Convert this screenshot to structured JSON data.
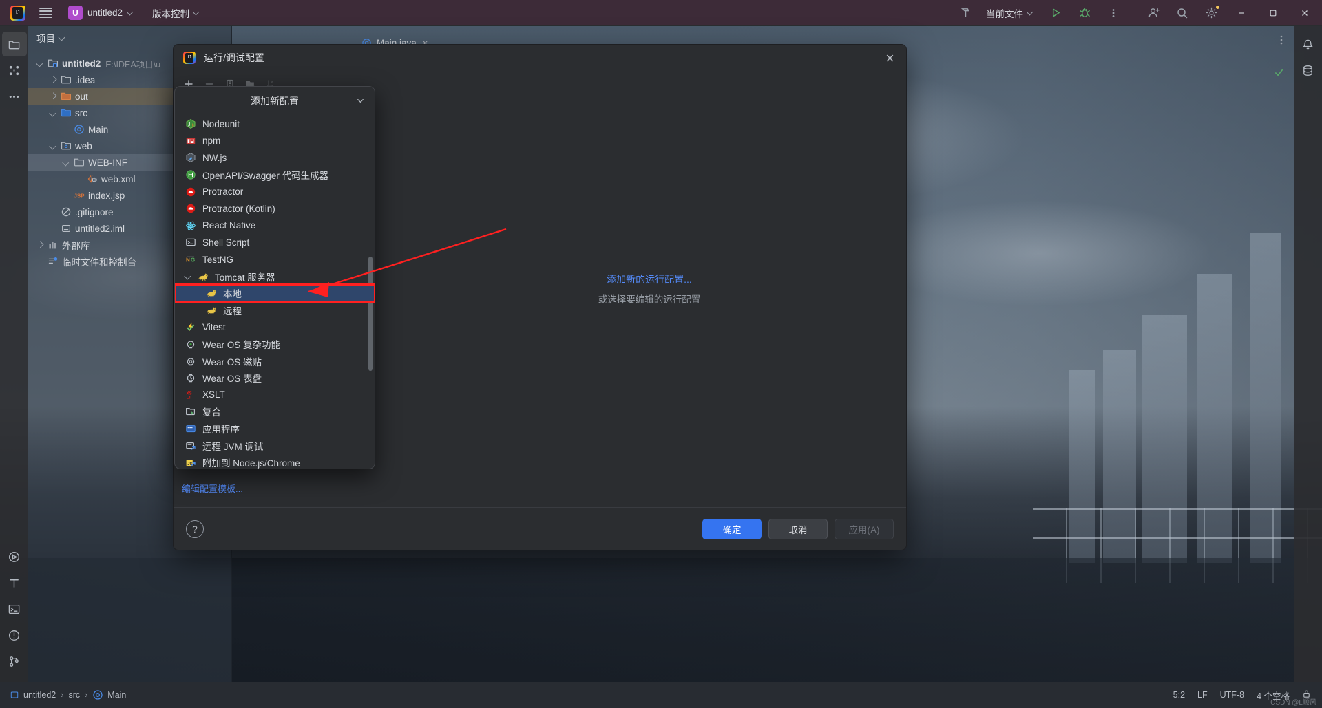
{
  "titlebar": {
    "menu_icon": "hamburger-menu-icon",
    "app_logo": "intellij-idea-logo",
    "project_badge": "U",
    "project_name": "untitled2",
    "vcs_label": "版本控制",
    "build_icon": "hammer-build-icon",
    "run_config_label": "当前文件",
    "run_icon": "run-triangle-icon",
    "debug_icon": "debug-bug-icon",
    "more_icon": "more-vertical-icon",
    "account_icon": "user-account-icon",
    "search_icon": "magnifier-search-icon",
    "settings_icon": "gear-settings-icon",
    "minimize": "−",
    "maximize": "◻",
    "close": "✕"
  },
  "activitybar": {
    "items": [
      {
        "name": "project-folder",
        "icon": "folder-icon"
      },
      {
        "name": "structure",
        "icon": "structure-icon"
      },
      {
        "name": "more-tool-windows",
        "icon": "ellipsis-icon"
      }
    ],
    "bottom_items": [
      {
        "name": "run",
        "icon": "run-circle-icon"
      },
      {
        "name": "ai-assistant",
        "icon": "text-tool-icon"
      },
      {
        "name": "terminal",
        "icon": "terminal-icon"
      },
      {
        "name": "problems",
        "icon": "warning-circle-icon"
      },
      {
        "name": "version-control-branch",
        "icon": "branch-icon"
      }
    ]
  },
  "rightbar": {
    "items": [
      {
        "name": "notifications",
        "icon": "bell-icon"
      },
      {
        "name": "database",
        "icon": "database-icon"
      }
    ]
  },
  "project_panel": {
    "header": "项目",
    "tree": [
      {
        "label": "untitled2",
        "path": "E:\\IDEA项目\\u",
        "icon": "module-folder-icon",
        "depth": 0,
        "arrow": "open",
        "bold": true,
        "state": ""
      },
      {
        "label": ".idea",
        "path": "",
        "icon": "folder-icon",
        "depth": 1,
        "arrow": "closed",
        "bold": false,
        "state": ""
      },
      {
        "label": "out",
        "path": "",
        "icon": "folder-orange-icon",
        "depth": 1,
        "arrow": "closed",
        "bold": false,
        "state": "sel-warm"
      },
      {
        "label": "src",
        "path": "",
        "icon": "folder-blue-icon",
        "depth": 1,
        "arrow": "open",
        "bold": false,
        "state": ""
      },
      {
        "label": "Main",
        "path": "",
        "icon": "java-class-icon",
        "depth": 2,
        "arrow": "none",
        "bold": false,
        "state": ""
      },
      {
        "label": "web",
        "path": "",
        "icon": "folder-web-icon",
        "depth": 1,
        "arrow": "open",
        "bold": false,
        "state": ""
      },
      {
        "label": "WEB-INF",
        "path": "",
        "icon": "folder-icon",
        "depth": 2,
        "arrow": "open",
        "bold": false,
        "state": "sel-grey"
      },
      {
        "label": "web.xml",
        "path": "",
        "icon": "xml-file-icon",
        "depth": 3,
        "arrow": "none",
        "bold": false,
        "state": ""
      },
      {
        "label": "index.jsp",
        "path": "",
        "icon": "jsp-file-icon",
        "depth": 2,
        "arrow": "none",
        "bold": false,
        "state": ""
      },
      {
        "label": ".gitignore",
        "path": "",
        "icon": "gitignore-file-icon",
        "depth": 1,
        "arrow": "none",
        "bold": false,
        "state": ""
      },
      {
        "label": "untitled2.iml",
        "path": "",
        "icon": "iml-file-icon",
        "depth": 1,
        "arrow": "none",
        "bold": false,
        "state": ""
      },
      {
        "label": "外部库",
        "path": "",
        "icon": "external-libraries-icon",
        "depth": 0,
        "arrow": "closed",
        "bold": false,
        "state": ""
      },
      {
        "label": "临时文件和控制台",
        "path": "",
        "icon": "scratches-consoles-icon",
        "depth": 0,
        "arrow": "none",
        "bold": false,
        "state": ""
      }
    ]
  },
  "editor": {
    "tab_label": "Main.java",
    "tab_icon": "java-class-icon",
    "inspection_ok_icon": "checkmark-icon",
    "more_icon": "more-vertical-icon"
  },
  "dialog": {
    "title": "运行/调试配置",
    "logo": "intellij-idea-logo",
    "close_icon": "close-x-icon",
    "toolbar": [
      {
        "name": "add-configuration-button",
        "icon": "plus-icon",
        "disabled": false
      },
      {
        "name": "remove-configuration-button",
        "icon": "minus-icon",
        "disabled": true
      },
      {
        "name": "copy-configuration-button",
        "icon": "copy-icon",
        "disabled": true
      },
      {
        "name": "new-folder-button",
        "icon": "folder-plus-icon",
        "disabled": true
      },
      {
        "name": "sort-configurations-button",
        "icon": "sort-az-icon",
        "disabled": true
      }
    ],
    "edit_templates_link": "编辑配置模板...",
    "empty_state": {
      "link": "添加新的运行配置...",
      "subtitle": "或选择要编辑的运行配置"
    },
    "footer": {
      "help": "?",
      "ok": "确定",
      "cancel": "取消",
      "apply": "应用(A)"
    }
  },
  "popup": {
    "title": "添加新配置",
    "collapse_icon": "collapse-chevron-icon",
    "items": [
      {
        "label": "Nodeunit",
        "icon": "nodeunit-icon",
        "kind": "leaf"
      },
      {
        "label": "npm",
        "icon": "npm-icon",
        "kind": "leaf"
      },
      {
        "label": "NW.js",
        "icon": "nwjs-icon",
        "kind": "leaf"
      },
      {
        "label": "OpenAPI/Swagger 代码生成器",
        "icon": "swagger-icon",
        "kind": "leaf"
      },
      {
        "label": "Protractor",
        "icon": "protractor-icon",
        "kind": "leaf"
      },
      {
        "label": "Protractor (Kotlin)",
        "icon": "protractor-icon",
        "kind": "leaf"
      },
      {
        "label": "React Native",
        "icon": "react-icon",
        "kind": "leaf"
      },
      {
        "label": "Shell Script",
        "icon": "shell-icon",
        "kind": "leaf"
      },
      {
        "label": "TestNG",
        "icon": "testng-icon",
        "kind": "leaf"
      },
      {
        "label": "Tomcat 服务器",
        "icon": "tomcat-icon",
        "kind": "group"
      },
      {
        "label": "本地",
        "icon": "tomcat-icon",
        "kind": "child",
        "selected": true,
        "highlighted": true
      },
      {
        "label": "远程",
        "icon": "tomcat-icon",
        "kind": "child"
      },
      {
        "label": "Vitest",
        "icon": "vitest-icon",
        "kind": "leaf"
      },
      {
        "label": "Wear OS 复杂功能",
        "icon": "wearos-complication-icon",
        "kind": "leaf"
      },
      {
        "label": "Wear OS 磁贴",
        "icon": "wearos-tile-icon",
        "kind": "leaf"
      },
      {
        "label": "Wear OS 表盘",
        "icon": "wearos-watchface-icon",
        "kind": "leaf"
      },
      {
        "label": "XSLT",
        "icon": "xslt-icon",
        "kind": "leaf"
      },
      {
        "label": "复合",
        "icon": "compound-icon",
        "kind": "leaf"
      },
      {
        "label": "应用程序",
        "icon": "application-icon",
        "kind": "leaf"
      },
      {
        "label": "远程 JVM 调试",
        "icon": "remote-jvm-debug-icon",
        "kind": "leaf"
      },
      {
        "label": "附加到 Node.js/Chrome",
        "icon": "attach-node-chrome-icon",
        "kind": "leaf"
      }
    ]
  },
  "statusbar": {
    "breadcrumb": [
      {
        "label": "untitled2",
        "icon": "module-icon"
      },
      {
        "label": "src",
        "icon": ""
      },
      {
        "label": "Main",
        "icon": "java-class-icon"
      }
    ],
    "caret": "5:2",
    "line_separator": "LF",
    "encoding": "UTF-8",
    "indent": "4 个空格",
    "lock_icon": "lock-icon",
    "watermark": "CSDN @L顺风"
  },
  "colors": {
    "accent_blue": "#3574f0",
    "link_blue": "#548af7",
    "selection_blue": "#2f466b",
    "annotation_red": "#ff2020",
    "titlebar_purple": "#3d2b38",
    "dialog_bg": "#2b2d30"
  }
}
